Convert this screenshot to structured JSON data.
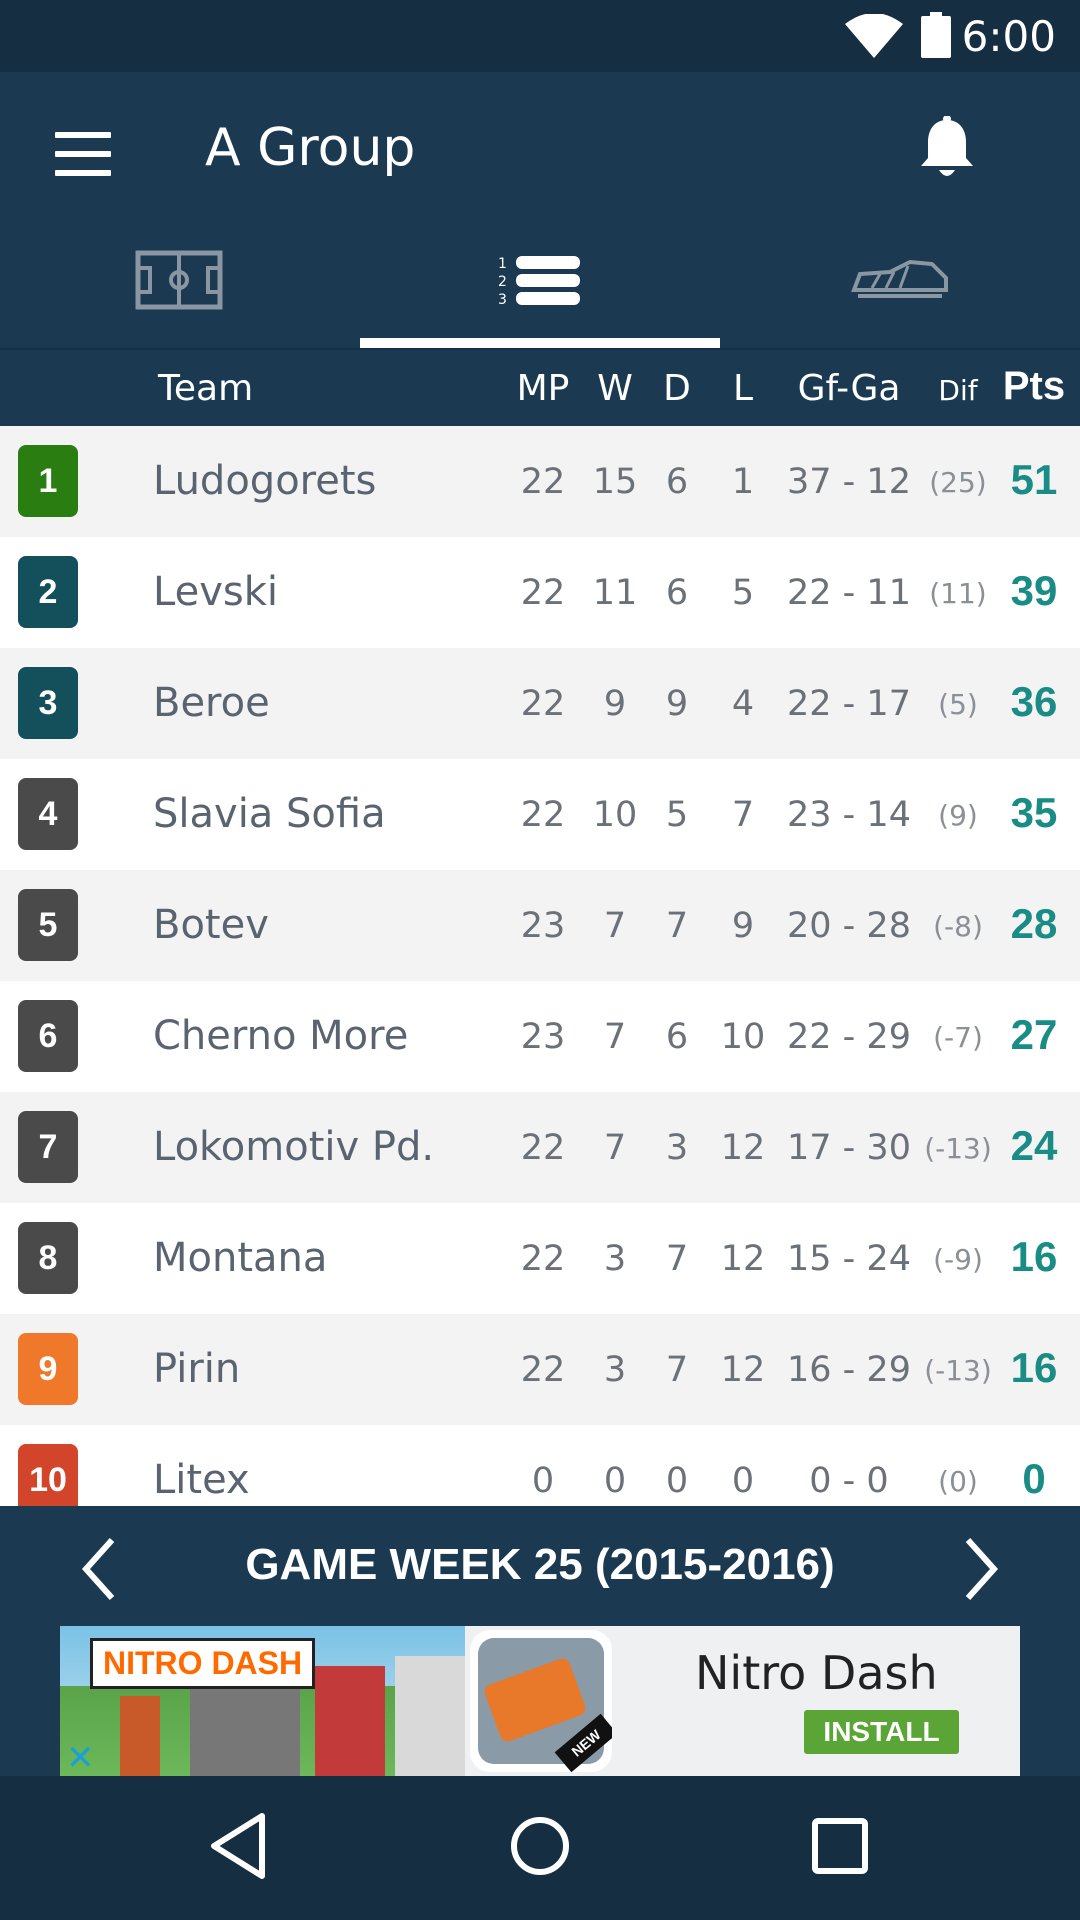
{
  "status_bar": {
    "time": "6:00"
  },
  "app_bar": {
    "title": "A Group"
  },
  "tabs": [
    {
      "icon": "soccer-field-icon"
    },
    {
      "icon": "standings-list-icon",
      "selected": true
    },
    {
      "icon": "football-boot-icon"
    }
  ],
  "table": {
    "headers": {
      "team": "Team",
      "mp": "MP",
      "w": "W",
      "d": "D",
      "l": "L",
      "gfga": "Gf-Ga",
      "dif": "Dif",
      "pts": "Pts"
    },
    "rows": [
      {
        "pos": "1",
        "team": "Ludogorets",
        "mp": "22",
        "w": "15",
        "d": "6",
        "l": "1",
        "gfga": "37 - 12",
        "dif": "(25)",
        "pts": "51",
        "color": "#2a7d10"
      },
      {
        "pos": "2",
        "team": "Levski",
        "mp": "22",
        "w": "11",
        "d": "6",
        "l": "5",
        "gfga": "22 - 11",
        "dif": "(11)",
        "pts": "39",
        "color": "#14505b"
      },
      {
        "pos": "3",
        "team": "Beroe",
        "mp": "22",
        "w": "9",
        "d": "9",
        "l": "4",
        "gfga": "22 - 17",
        "dif": "(5)",
        "pts": "36",
        "color": "#14505b"
      },
      {
        "pos": "4",
        "team": "Slavia Sofia",
        "mp": "22",
        "w": "10",
        "d": "5",
        "l": "7",
        "gfga": "23 - 14",
        "dif": "(9)",
        "pts": "35",
        "color": "#4a4a4a"
      },
      {
        "pos": "5",
        "team": "Botev",
        "mp": "23",
        "w": "7",
        "d": "7",
        "l": "9",
        "gfga": "20 - 28",
        "dif": "(-8)",
        "pts": "28",
        "color": "#4a4a4a"
      },
      {
        "pos": "6",
        "team": "Cherno More",
        "mp": "23",
        "w": "7",
        "d": "6",
        "l": "10",
        "gfga": "22 - 29",
        "dif": "(-7)",
        "pts": "27",
        "color": "#4a4a4a"
      },
      {
        "pos": "7",
        "team": "Lokomotiv Pd.",
        "mp": "22",
        "w": "7",
        "d": "3",
        "l": "12",
        "gfga": "17 - 30",
        "dif": "(-13)",
        "pts": "24",
        "color": "#4a4a4a"
      },
      {
        "pos": "8",
        "team": "Montana",
        "mp": "22",
        "w": "3",
        "d": "7",
        "l": "12",
        "gfga": "15 - 24",
        "dif": "(-9)",
        "pts": "16",
        "color": "#4a4a4a"
      },
      {
        "pos": "9",
        "team": "Pirin",
        "mp": "22",
        "w": "3",
        "d": "7",
        "l": "12",
        "gfga": "16 - 29",
        "dif": "(-13)",
        "pts": "16",
        "color": "#f0782a"
      },
      {
        "pos": "10",
        "team": "Litex",
        "mp": "0",
        "w": "0",
        "d": "0",
        "l": "0",
        "gfga": "0 - 0",
        "dif": "(0)",
        "pts": "0",
        "color": "#d2452a"
      }
    ]
  },
  "game_week": {
    "title": "GAME WEEK 25 (2015-2016)"
  },
  "ad": {
    "logo_text": "NITRO DASH",
    "app_name": "Nitro Dash",
    "install_label": "INSTALL",
    "badge": "NEW",
    "close": "✕"
  },
  "nav": [
    {
      "icon": "back-icon"
    },
    {
      "icon": "home-icon"
    },
    {
      "icon": "recents-icon"
    }
  ]
}
